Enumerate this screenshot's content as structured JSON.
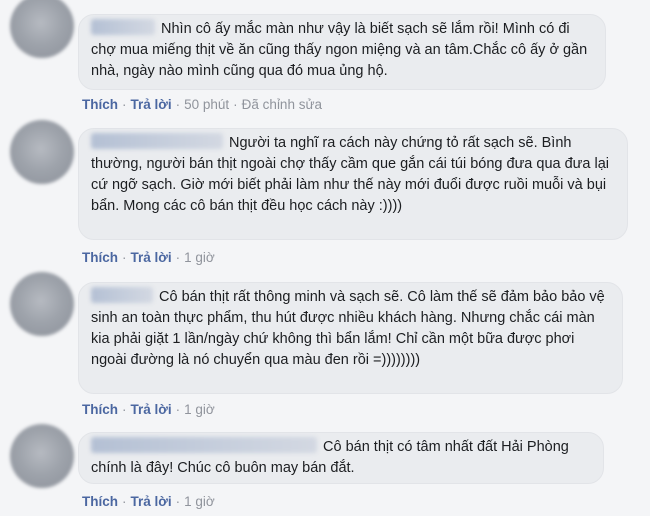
{
  "comments": [
    {
      "text": "Nhìn cô ấy mắc màn như vậy là biết sạch sẽ lắm rồi! Mình có đi chợ mua miếng thịt về ăn cũng thấy ngon miệng và an tâm.Chắc cô ấy ở gần nhà, ngày nào mình cũng qua đó mua ủng hộ.",
      "like": "Thích",
      "reply": "Trả lời",
      "time": "50 phút",
      "edited": "Đã chỉnh sửa"
    },
    {
      "text": "Người ta nghĩ ra cách này chứng tỏ rất sạch sẽ. Bình thường, người bán thịt ngoài chợ thấy cầm que gắn cái túi bóng đưa qua đưa lại cứ ngỡ sạch. Giờ mới biết phải làm như thế này mới đuổi được ruồi muỗi và bụi bẩn. Mong các cô bán thịt đều học cách này :))))",
      "like": "Thích",
      "reply": "Trả lời",
      "time": "1 giờ"
    },
    {
      "text": "Cô bán thịt rất thông minh và sạch sẽ. Cô làm thế sẽ đảm bảo bảo vệ sinh an toàn thực phẩm, thu hút được nhiều khách hàng. Nhưng chắc cái màn kia phải giặt 1 lần/ngày chứ không thì bẩn lắm! Chỉ cần một bữa được phơi ngoài đường là nó chuyển qua màu đen rồi =))))))))",
      "like": "Thích",
      "reply": "Trả lời",
      "time": "1 giờ"
    },
    {
      "text": "Cô bán thịt có tâm nhất đất Hải Phòng chính là đây! Chúc cô buôn may bán đắt.",
      "like": "Thích",
      "reply": "Trả lời",
      "time": "1 giờ"
    }
  ]
}
